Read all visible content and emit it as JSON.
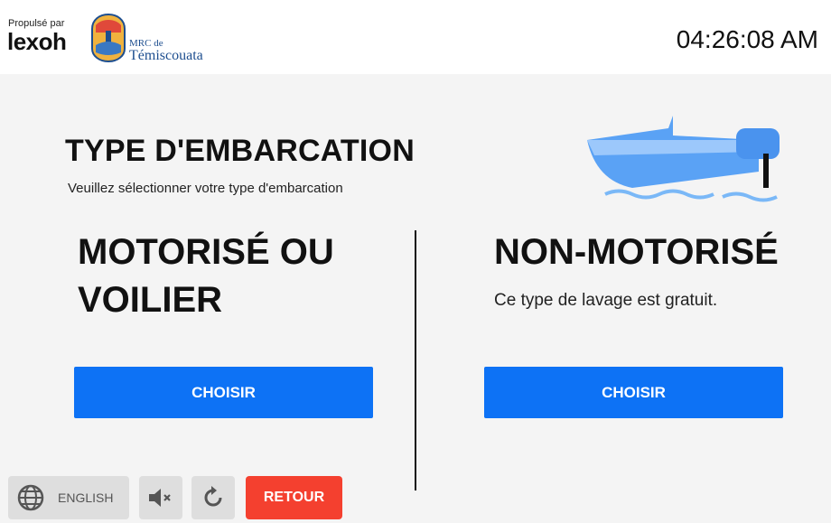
{
  "header": {
    "powered_by": "Propulsé par",
    "brand": "lexoh",
    "org_small": "MRC de",
    "org_name": "Témiscouata",
    "clock": "04:26:08 AM"
  },
  "main": {
    "title": "TYPE D'EMBARCATION",
    "subtitle": "Veuillez sélectionner votre type d'embarcation",
    "options": [
      {
        "title_line1": "MOTORISÉ OU",
        "title_line2": "VOILIER",
        "description": "",
        "button": "CHOISIR"
      },
      {
        "title_line1": "NON-MOTORISÉ",
        "title_line2": "",
        "description": "Ce type de lavage est gratuit.",
        "button": "CHOISIR"
      }
    ]
  },
  "footer": {
    "language_label": "ENGLISH",
    "back_label": "RETOUR"
  },
  "icons": {
    "language": "globe-icon",
    "mute": "speaker-muted-icon",
    "reset": "refresh-icon",
    "illustration": "boat-icon"
  },
  "colors": {
    "primary_button": "#0d72f5",
    "back_button": "#f4402f",
    "background": "#f4f4f4"
  }
}
